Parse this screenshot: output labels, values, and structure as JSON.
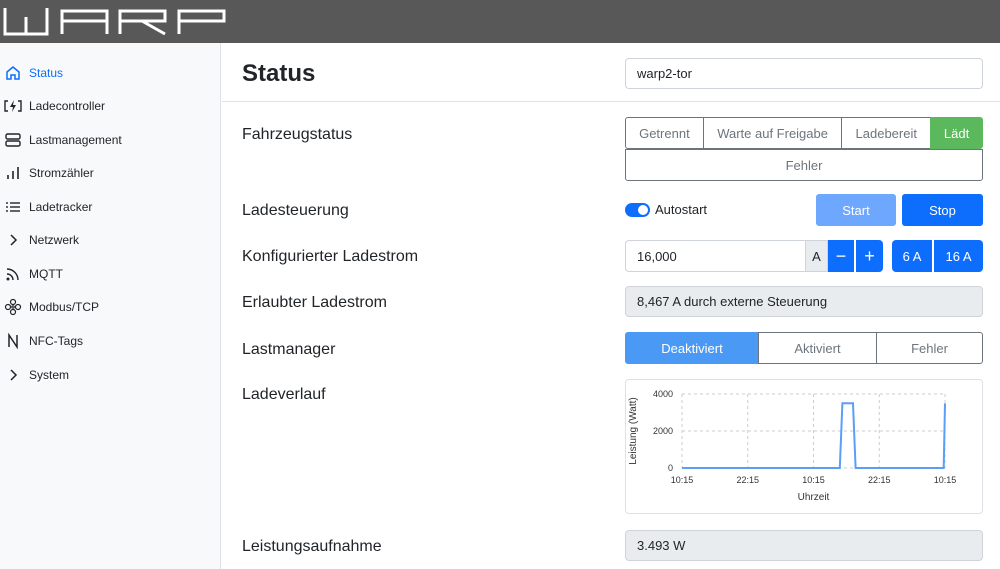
{
  "header": {
    "logo": "warp"
  },
  "sidebar": {
    "items": [
      {
        "label": "Status",
        "icon": "home-icon",
        "active": true
      },
      {
        "label": "Ladecontroller",
        "icon": "charger-icon"
      },
      {
        "label": "Lastmanagement",
        "icon": "server-icon"
      },
      {
        "label": "Stromzähler",
        "icon": "bar-chart-icon"
      },
      {
        "label": "Ladetracker",
        "icon": "list-icon"
      },
      {
        "label": "Netzwerk",
        "icon": "chevron-right-icon"
      },
      {
        "label": "MQTT",
        "icon": "rss-icon"
      },
      {
        "label": "Modbus/TCP",
        "icon": "modbus-icon"
      },
      {
        "label": "NFC-Tags",
        "icon": "nfc-icon"
      },
      {
        "label": "System",
        "icon": "chevron-right-icon"
      }
    ]
  },
  "main": {
    "title": "Status",
    "device_name": "warp2-tor",
    "fahrzeugstatus": {
      "label": "Fahrzeugstatus",
      "states": [
        "Getrennt",
        "Warte auf Freigabe",
        "Ladebereit",
        "Lädt"
      ],
      "active": "Lädt",
      "error": "Fehler"
    },
    "ladesteuerung": {
      "label": "Ladesteuerung",
      "autostart_label": "Autostart",
      "autostart_on": true,
      "start_label": "Start",
      "stop_label": "Stop"
    },
    "konfigurierter_ladestrom": {
      "label": "Konfigurierter Ladestrom",
      "value": "16,000",
      "unit": "A",
      "minus": "−",
      "plus": "+",
      "preset_6": "6 A",
      "preset_16": "16 A"
    },
    "erlaubter_ladestrom": {
      "label": "Erlaubter Ladestrom",
      "value": "8,467 A durch externe Steuerung"
    },
    "lastmanager": {
      "label": "Lastmanager",
      "states": [
        "Deaktiviert",
        "Aktiviert",
        "Fehler"
      ],
      "active": "Deaktiviert"
    },
    "ladeverlauf": {
      "label": "Ladeverlauf"
    },
    "leistungsaufnahme": {
      "label": "Leistungsaufnahme",
      "value": "3.493 W"
    }
  },
  "colors": {
    "primary": "#0d6efd",
    "start_disabled": "#6ea8fe",
    "success": "#5cb85c",
    "line": "#5a9ef8"
  },
  "chart_data": {
    "type": "line",
    "xlabel": "Uhrzeit",
    "ylabel": "Leistung (Watt)",
    "ylim": [
      0,
      4000
    ],
    "yticks": [
      "4000",
      "2000",
      "0"
    ],
    "xticks": [
      "10:15",
      "22:15",
      "10:15",
      "22:15",
      "10:15"
    ],
    "series": [
      {
        "x": [
          0,
          0.6,
          0.61,
          0.65,
          0.66,
          0.995,
          1.0
        ],
        "values": [
          0,
          0,
          3500,
          3500,
          0,
          0,
          3493
        ]
      }
    ]
  }
}
